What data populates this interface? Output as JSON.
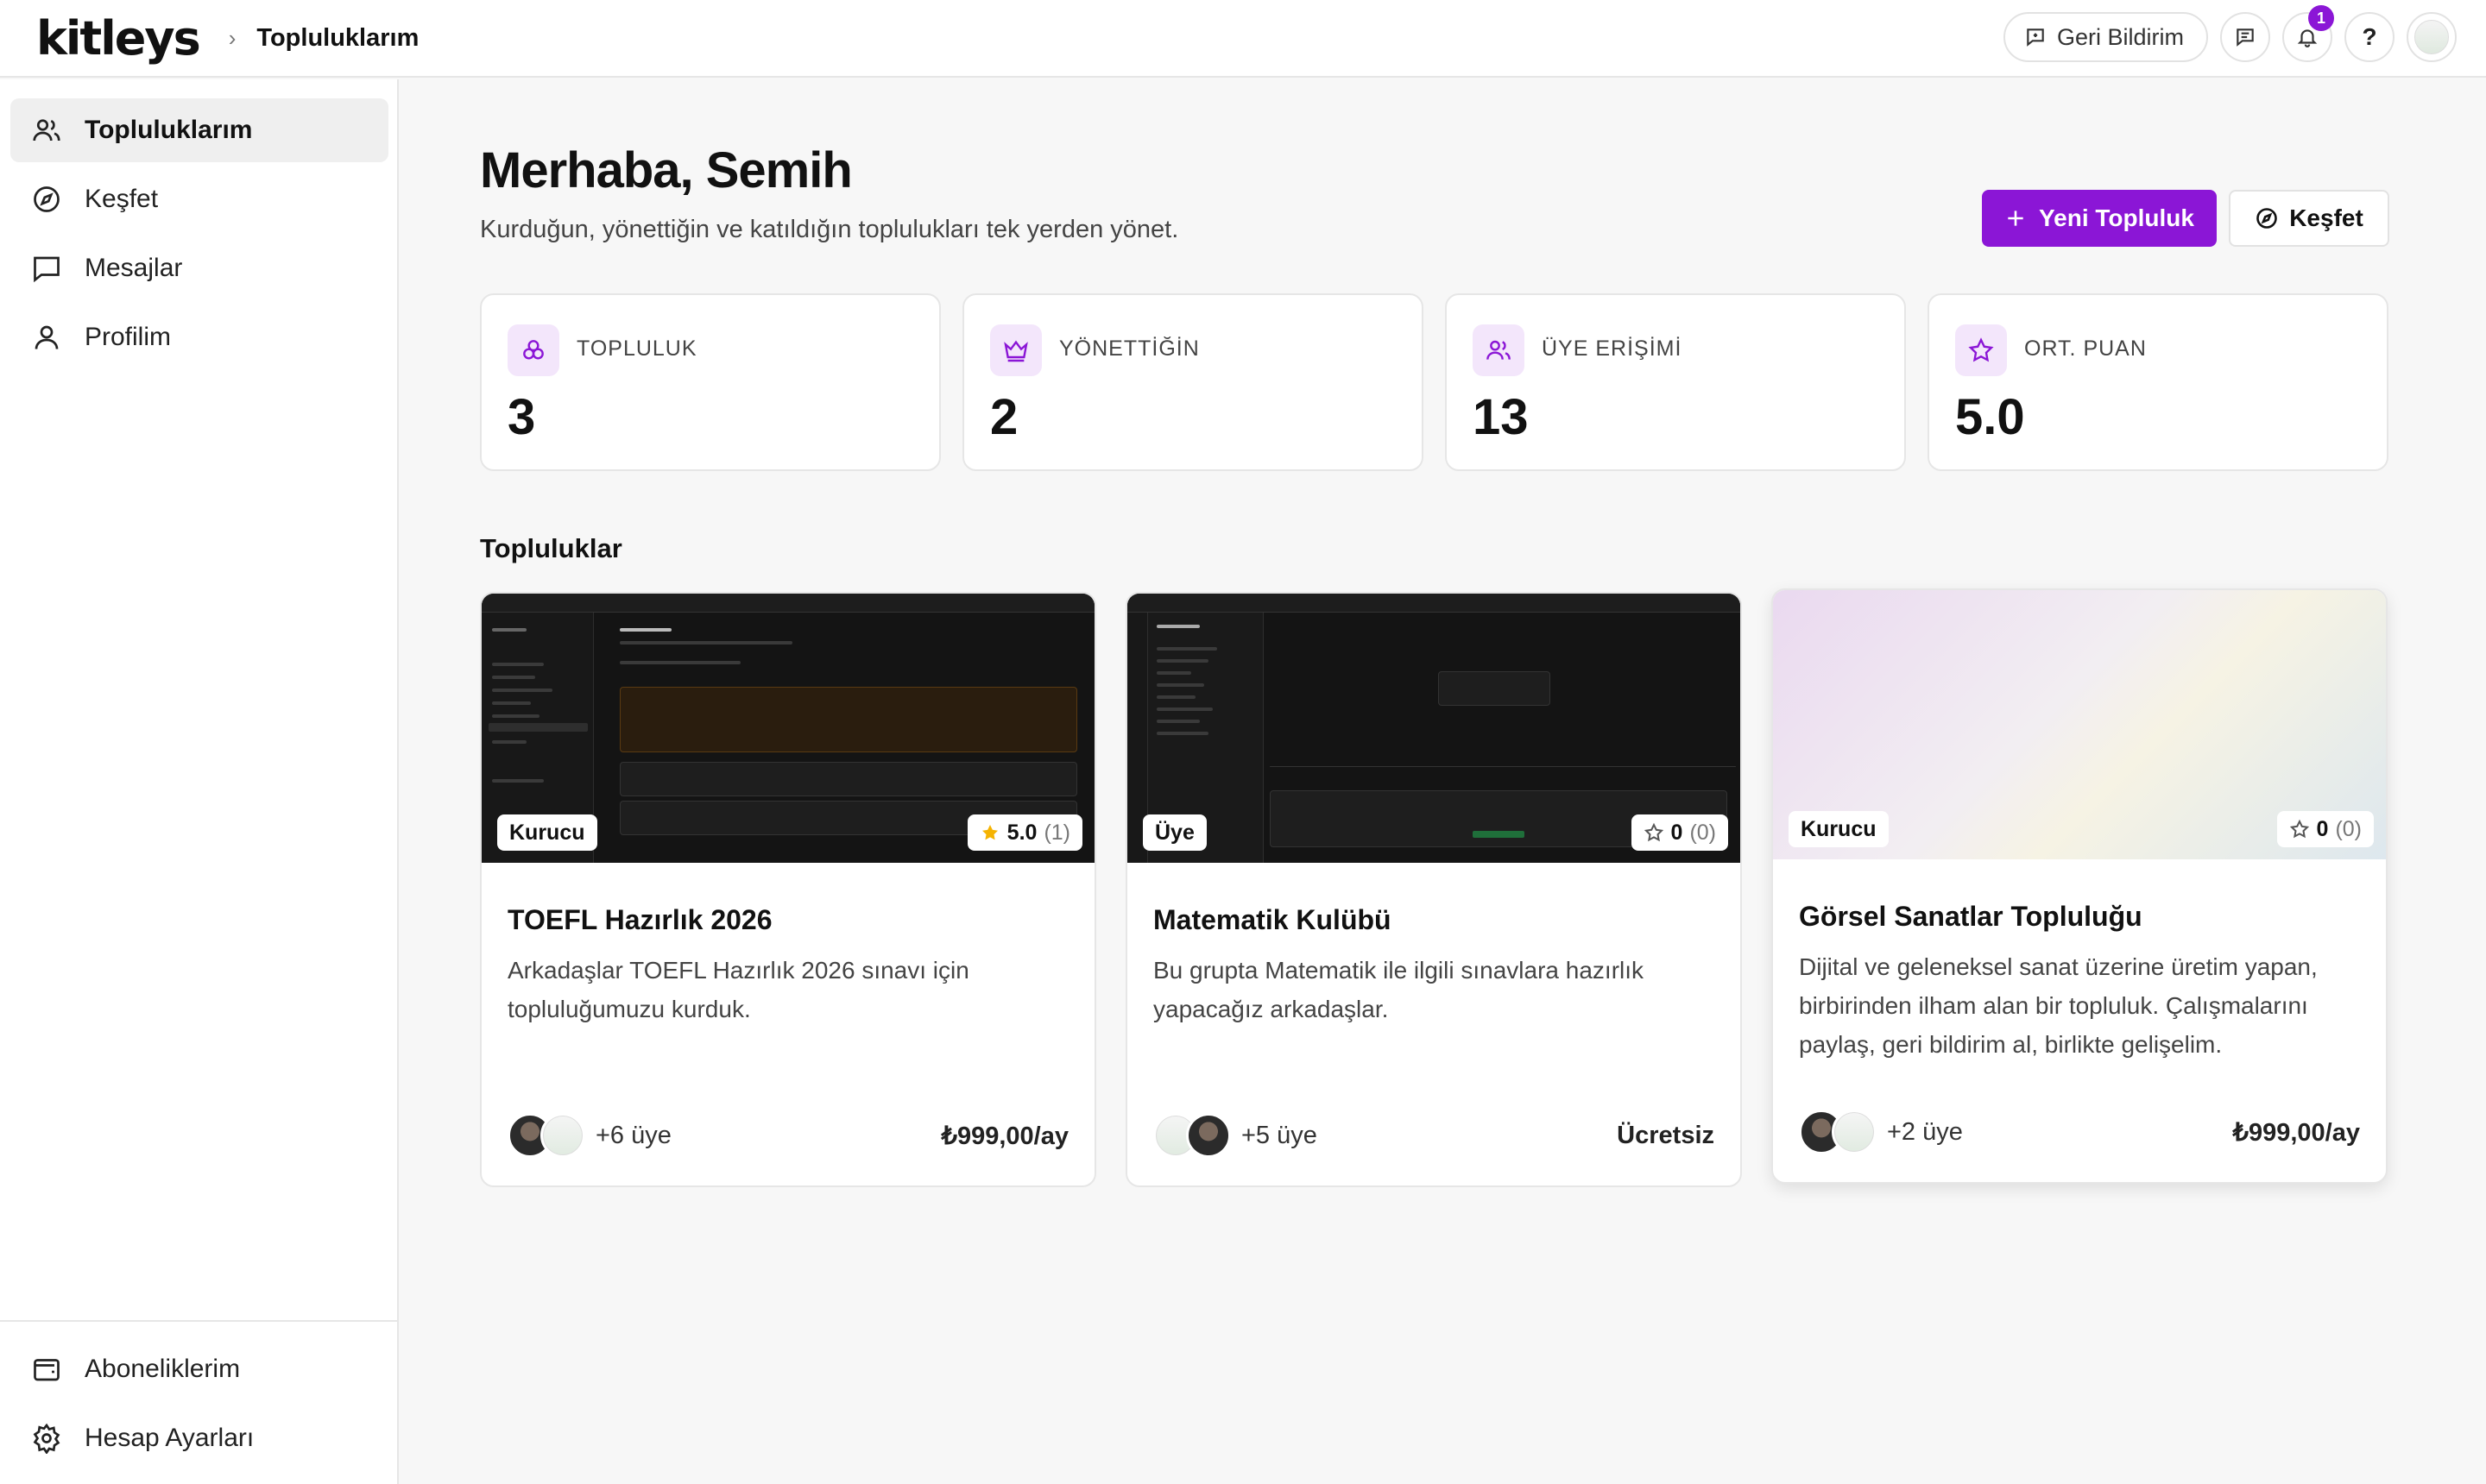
{
  "topbar": {
    "logo": "kitleys",
    "breadcrumb_separator": "›",
    "breadcrumb_current": "Topluluklarım",
    "feedback_label": "Geri Bildirim",
    "notification_count": "1",
    "help_label": "?"
  },
  "sidebar": {
    "items": [
      {
        "label": "Topluluklarım",
        "icon": "users-icon",
        "active": true
      },
      {
        "label": "Keşfet",
        "icon": "compass-icon",
        "active": false
      },
      {
        "label": "Mesajlar",
        "icon": "message-icon",
        "active": false
      },
      {
        "label": "Profilim",
        "icon": "user-icon",
        "active": false
      }
    ],
    "bottom_items": [
      {
        "label": "Aboneliklerim",
        "icon": "wallet-icon"
      },
      {
        "label": "Hesap Ayarları",
        "icon": "gear-icon"
      }
    ]
  },
  "header": {
    "greeting": "Merhaba, Semih",
    "subtitle": "Kurduğun, yönettiğin ve katıldığın toplulukları tek yerden yönet.",
    "new_button": "Yeni Topluluk",
    "explore_button": "Keşfet"
  },
  "stats": [
    {
      "label": "TOPLULUK",
      "value": "3",
      "icon": "community-icon"
    },
    {
      "label": "YÖNETTİĞİN",
      "value": "2",
      "icon": "crown-icon"
    },
    {
      "label": "ÜYE ERİŞİMİ",
      "value": "13",
      "icon": "users-icon"
    },
    {
      "label": "ORT. PUAN",
      "value": "5.0",
      "icon": "star-icon"
    }
  ],
  "section_title": "Topluluklar",
  "communities": [
    {
      "title": "TOEFL Hazırlık 2026",
      "description": "Arkadaşlar TOEFL Hazırlık 2026 sınavı için topluluğumuzu kurduk.",
      "role": "Kurucu",
      "rating": "5.0",
      "rating_count": "(1)",
      "members": "+6 üye",
      "price": "₺999,00/ay"
    },
    {
      "title": "Matematik Kulübü",
      "description": "Bu grupta Matematik ile ilgili sınavlara hazırlık yapacağız arkadaşlar.",
      "role": "Üye",
      "rating": "0",
      "rating_count": "(0)",
      "members": "+5 üye",
      "price": "Ücretsiz"
    },
    {
      "title": "Görsel Sanatlar Topluluğu",
      "description": "Dijital ve geleneksel sanat üzerine üretim yapan, birbirinden ilham alan bir topluluk. Çalışmalarını paylaş, geri bildirim al, birlikte gelişelim.",
      "role": "Kurucu",
      "rating": "0",
      "rating_count": "(0)",
      "members": "+2 üye",
      "price": "₺999,00/ay"
    }
  ],
  "colors": {
    "accent": "#8b16d6",
    "accent_light": "#f3e6fb",
    "star": "#f5b301"
  }
}
